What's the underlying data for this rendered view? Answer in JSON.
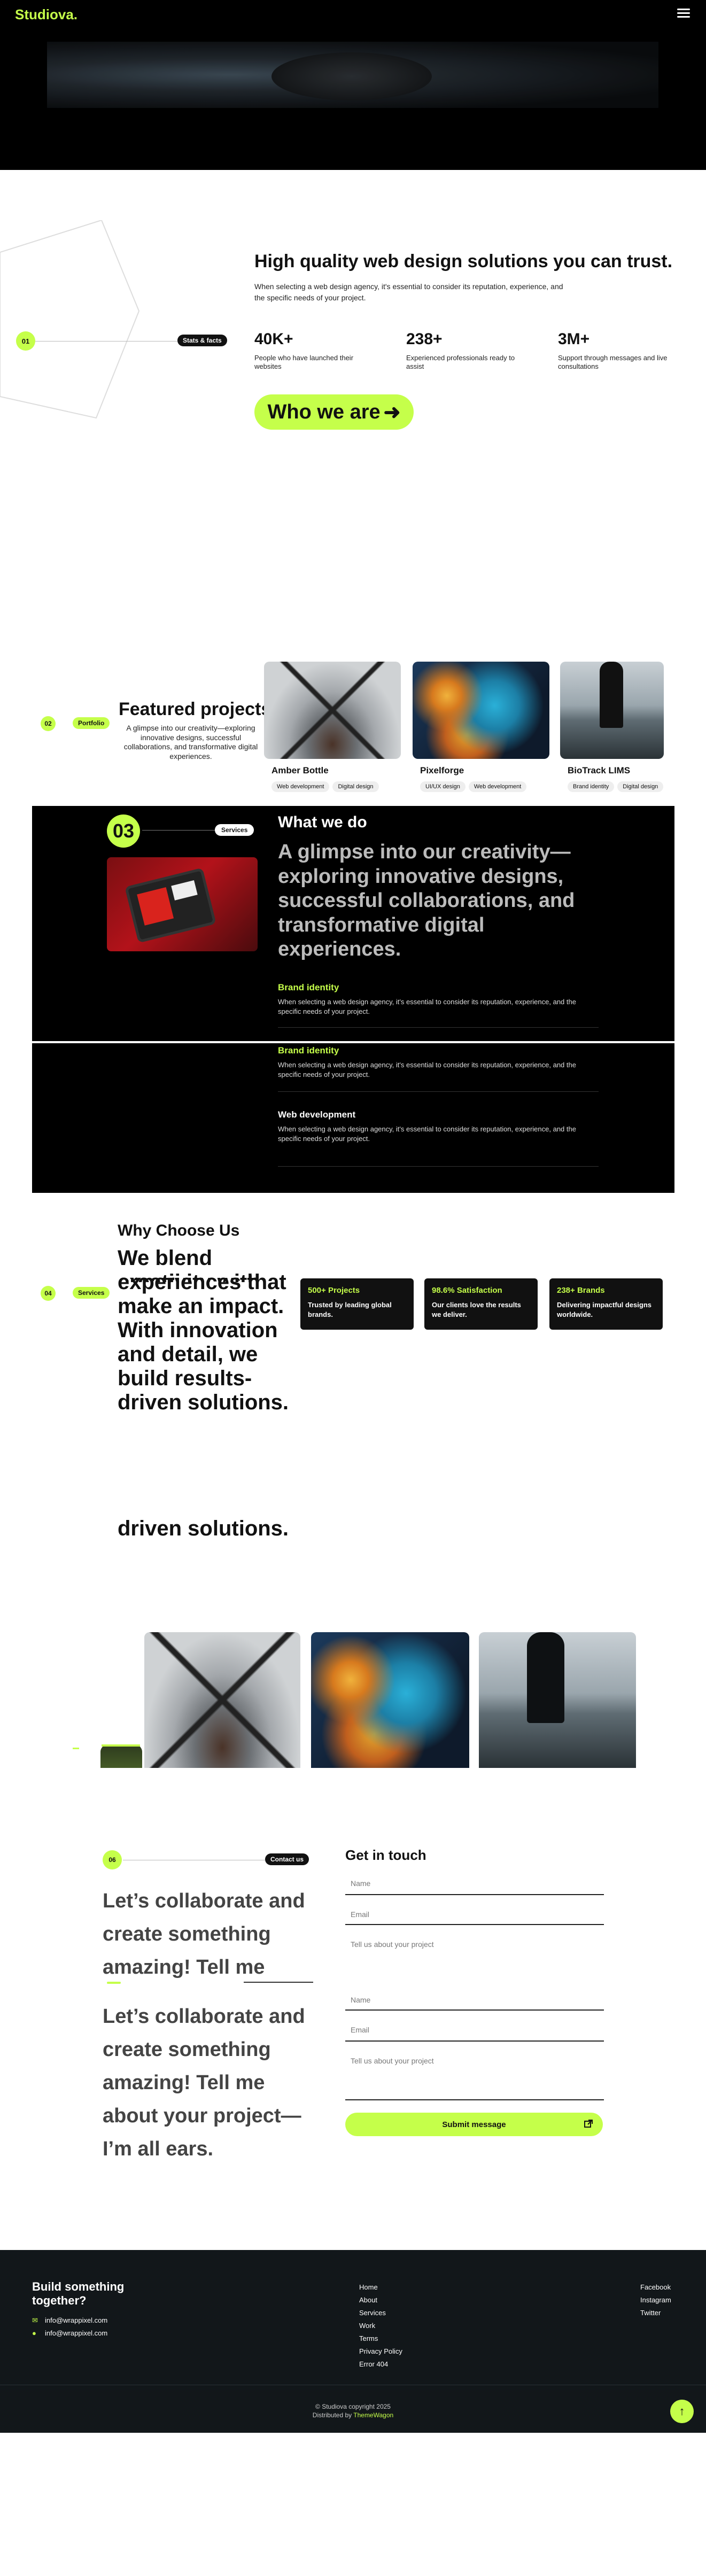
{
  "header": {
    "logo": "Studiova.",
    "menu_icon": "hamburger-icon"
  },
  "about": {
    "number": "01",
    "tag": "Stats & facts",
    "headline": "High quality web design solutions you can trust.",
    "description": "When selecting a web design agency, it's essential to consider its reputation, experience, and the specific needs of your project.",
    "stats": [
      {
        "value": "40K+",
        "label": "People who have launched their websites"
      },
      {
        "value": "238+",
        "label": "Experienced professionals ready to assist"
      },
      {
        "value": "3M+",
        "label": "Support through messages and live consultations"
      }
    ],
    "cta_label": "Who we are",
    "cta_icon": "arrow-right-icon"
  },
  "portfolio": {
    "number": "02",
    "tag": "Portfolio",
    "title": "Featured projects",
    "description": "A glimpse into our creativity—exploring innovative designs, successful collaborations, and transformative digital experiences.",
    "projects": [
      {
        "title": "Amber Bottle",
        "tags": [
          "Web development",
          "Digital design"
        ]
      },
      {
        "title": "Pixelforge",
        "tags": [
          "UI/UX design",
          "Web development"
        ]
      },
      {
        "title": "BioTrack LIMS",
        "tags": [
          "Brand identity",
          "Digital design"
        ]
      }
    ]
  },
  "services": {
    "number": "03",
    "tag": "Services",
    "title": "What we do",
    "headline": "A glimpse into our creativity—exploring innovative designs, successful collaborations, and transformative digital experiences.",
    "items": [
      {
        "title": "Brand identity",
        "desc": "When selecting a web design agency, it's essential to consider its reputation, experience, and the specific needs of your project."
      },
      {
        "title": "Brand identity",
        "desc": "When selecting a web design agency, it's essential to consider its reputation, experience, and the specific needs of your project."
      },
      {
        "title": "Web development",
        "desc": "When selecting a web design agency, it's essential to consider its reputation, experience, and the specific needs of your project."
      }
    ]
  },
  "why": {
    "number": "04",
    "tag": "Services",
    "title": "Why Choose Us",
    "headline_lines": [
      "We blend",
      "creativity with",
      "experiences that",
      "make an impact.",
      "With innovation",
      "and detail, we",
      "build results-",
      "driven solutions."
    ],
    "echo": "driven solutions.",
    "cards": [
      {
        "title": "500+ Projects",
        "desc": "Trusted by leading global brands."
      },
      {
        "title": "98.6% Satisfaction",
        "desc": "Our clients love the results we deliver."
      },
      {
        "title": "238+ Brands",
        "desc": "Delivering impactful designs worldwide."
      }
    ]
  },
  "contact": {
    "number": "06",
    "tag": "Contact us",
    "headline_a": [
      "Let’s collaborate and",
      "create something",
      "amazing! Tell me"
    ],
    "headline_b": [
      "Let’s collaborate and",
      "create something",
      "amazing! Tell me",
      "about your project—",
      "I’m all ears."
    ],
    "form_title": "Get in touch",
    "name_placeholder": "Name",
    "email_placeholder": "Email",
    "message_placeholder": "Tell us about your project",
    "submit_label": "Submit message",
    "submit_icon": "external-link-icon"
  },
  "footer": {
    "heading": "Build something together?",
    "email1": "info@wrappixel.com",
    "email2": "info@wrappixel.com",
    "links": [
      "Home",
      "About",
      "Services",
      "Work",
      "Terms",
      "Privacy Policy",
      "Error 404"
    ],
    "social": [
      "Facebook",
      "Instagram",
      "Twitter"
    ],
    "copyright": "© Studiova copyright 2025",
    "distributed_prefix": "Distributed by",
    "distributed_by": "ThemeWagon",
    "top_icon": "arrow-up-icon"
  }
}
